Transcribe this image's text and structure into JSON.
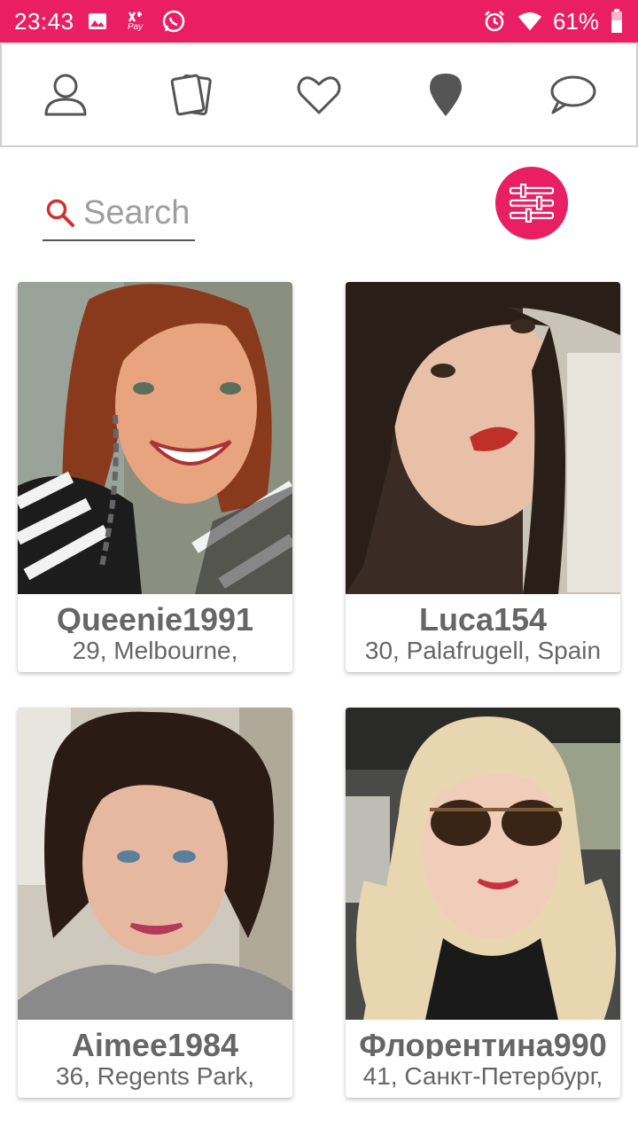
{
  "status_bar": {
    "time": "23:43",
    "battery": "61%",
    "background_color": "#e91e63",
    "icons_left": [
      "image-icon",
      "pay-icon",
      "whatsapp-icon"
    ],
    "icons_right": [
      "alarm-icon",
      "wifi-icon",
      "battery-icon"
    ],
    "pay_label": "Pay"
  },
  "nav": {
    "items": [
      {
        "icon": "profile-icon"
      },
      {
        "icon": "cards-icon"
      },
      {
        "icon": "heart-icon"
      },
      {
        "icon": "location-pin-icon"
      },
      {
        "icon": "chat-bubble-icon"
      }
    ]
  },
  "search": {
    "placeholder": "Search",
    "value": ""
  },
  "filter_button": {
    "icon": "sliders-icon",
    "color": "#e91e63"
  },
  "profiles": [
    {
      "name": "Queenie1991",
      "location": "29, Melbourne,"
    },
    {
      "name": "Luca154",
      "location": "30, Palafrugell, Spain"
    },
    {
      "name": "Aimee1984",
      "location": "36, Regents Park,"
    },
    {
      "name": "Флорентина990",
      "location": "41, Санкт-Петербург,"
    }
  ],
  "colors": {
    "accent": "#e91e63",
    "text_secondary": "#666666",
    "nav_icon": "#555555"
  }
}
